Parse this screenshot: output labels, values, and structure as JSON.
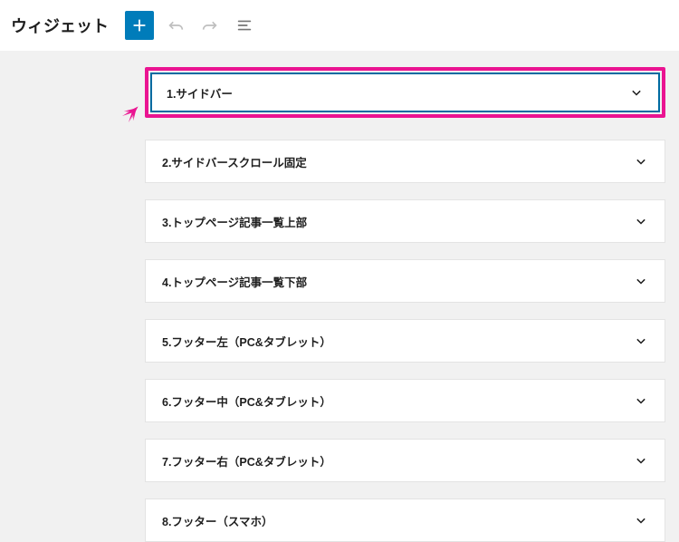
{
  "header": {
    "title": "ウィジェット"
  },
  "panels": [
    {
      "label": "1.サイドバー",
      "highlighted": true
    },
    {
      "label": "2.サイドバースクロール固定",
      "highlighted": false
    },
    {
      "label": "3.トップページ記事一覧上部",
      "highlighted": false
    },
    {
      "label": "4.トップページ記事一覧下部",
      "highlighted": false
    },
    {
      "label": "5.フッター左（PC&タブレット）",
      "highlighted": false
    },
    {
      "label": "6.フッター中（PC&タブレット）",
      "highlighted": false
    },
    {
      "label": "7.フッター右（PC&タブレット）",
      "highlighted": false
    },
    {
      "label": "8.フッター（スマホ）",
      "highlighted": false
    }
  ]
}
